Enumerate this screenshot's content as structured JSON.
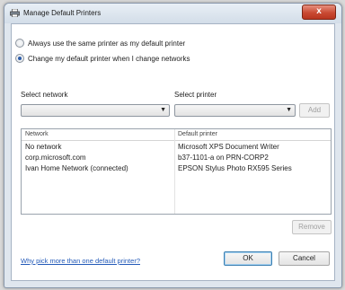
{
  "window": {
    "title": "Manage Default Printers",
    "close_glyph": "x"
  },
  "options": {
    "same_printer": "Always use the same printer as my default printer",
    "change_by_network": "Change my default printer when I change networks",
    "selected": "change_by_network"
  },
  "selectors": {
    "network_label": "Select network",
    "printer_label": "Select printer",
    "network_value": "",
    "printer_value": "",
    "add_label": "Add"
  },
  "table": {
    "columns": [
      "Network",
      "Default printer"
    ],
    "rows": [
      {
        "network": "No network",
        "printer": "Microsoft XPS Document Writer"
      },
      {
        "network": "corp.microsoft.com",
        "printer": "b37-1101-a on PRN-CORP2"
      },
      {
        "network": "Ivan Home Network (connected)",
        "printer": "EPSON Stylus Photo RX595 Series"
      }
    ]
  },
  "remove_label": "Remove",
  "help_link": "Why pick more than one default printer?",
  "ok_label": "OK",
  "cancel_label": "Cancel"
}
